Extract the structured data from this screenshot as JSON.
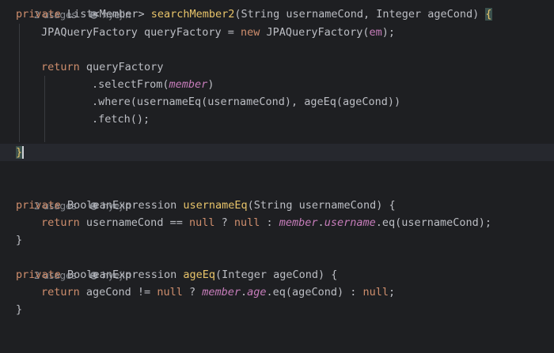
{
  "editor": {
    "hint_top": {
      "usages": "2 usages",
      "author": "hyejin"
    },
    "method1": {
      "kw_private": "private",
      "ret_type": "List<Member>",
      "name": "searchMember2",
      "params": "(String usernameCond, Integer ageCond) ",
      "open_brace": "{",
      "line2": {
        "type": "JPAQueryFactory",
        "var": " queryFactory = ",
        "kw_new": "new",
        "ctor": " JPAQueryFactory(",
        "arg": "em",
        "end": ");"
      },
      "line4": {
        "kw_return": "return",
        "rest": " queryFactory"
      },
      "line5": {
        "call": ".selectFrom(",
        "arg": "member",
        "end": ")"
      },
      "line6": ".where(usernameEq(usernameCond), ageEq(ageCond))",
      "line7": ".fetch();",
      "close_brace": "}"
    },
    "method2": {
      "usages": "2 usages",
      "author": "hyejin",
      "kw_private": "private",
      "ret_type": "BooleanExpression",
      "name": "usernameEq",
      "params": "(String usernameCond) {",
      "body": {
        "kw_return": "return",
        "a": " usernameCond == ",
        "null1": "null",
        "q": " ? ",
        "null2": "null",
        "colon": " : ",
        "f1": "member",
        "dot1": ".",
        "f2": "username",
        "tail": ".eq(usernameCond);"
      },
      "close_brace": "}"
    },
    "method3": {
      "usages": "2 usages",
      "author": "hyejin",
      "kw_private": "private",
      "ret_type": "BooleanExpression",
      "name": "ageEq",
      "params": "(Integer ageCond) {",
      "body": {
        "kw_return": "return",
        "a": " ageCond != ",
        "null1": "null",
        "q": " ? ",
        "f1": "member",
        "dot1": ".",
        "f2": "age",
        "tail": ".eq(ageCond) : ",
        "null2": "null",
        "end": ";"
      },
      "close_brace": "}"
    }
  }
}
